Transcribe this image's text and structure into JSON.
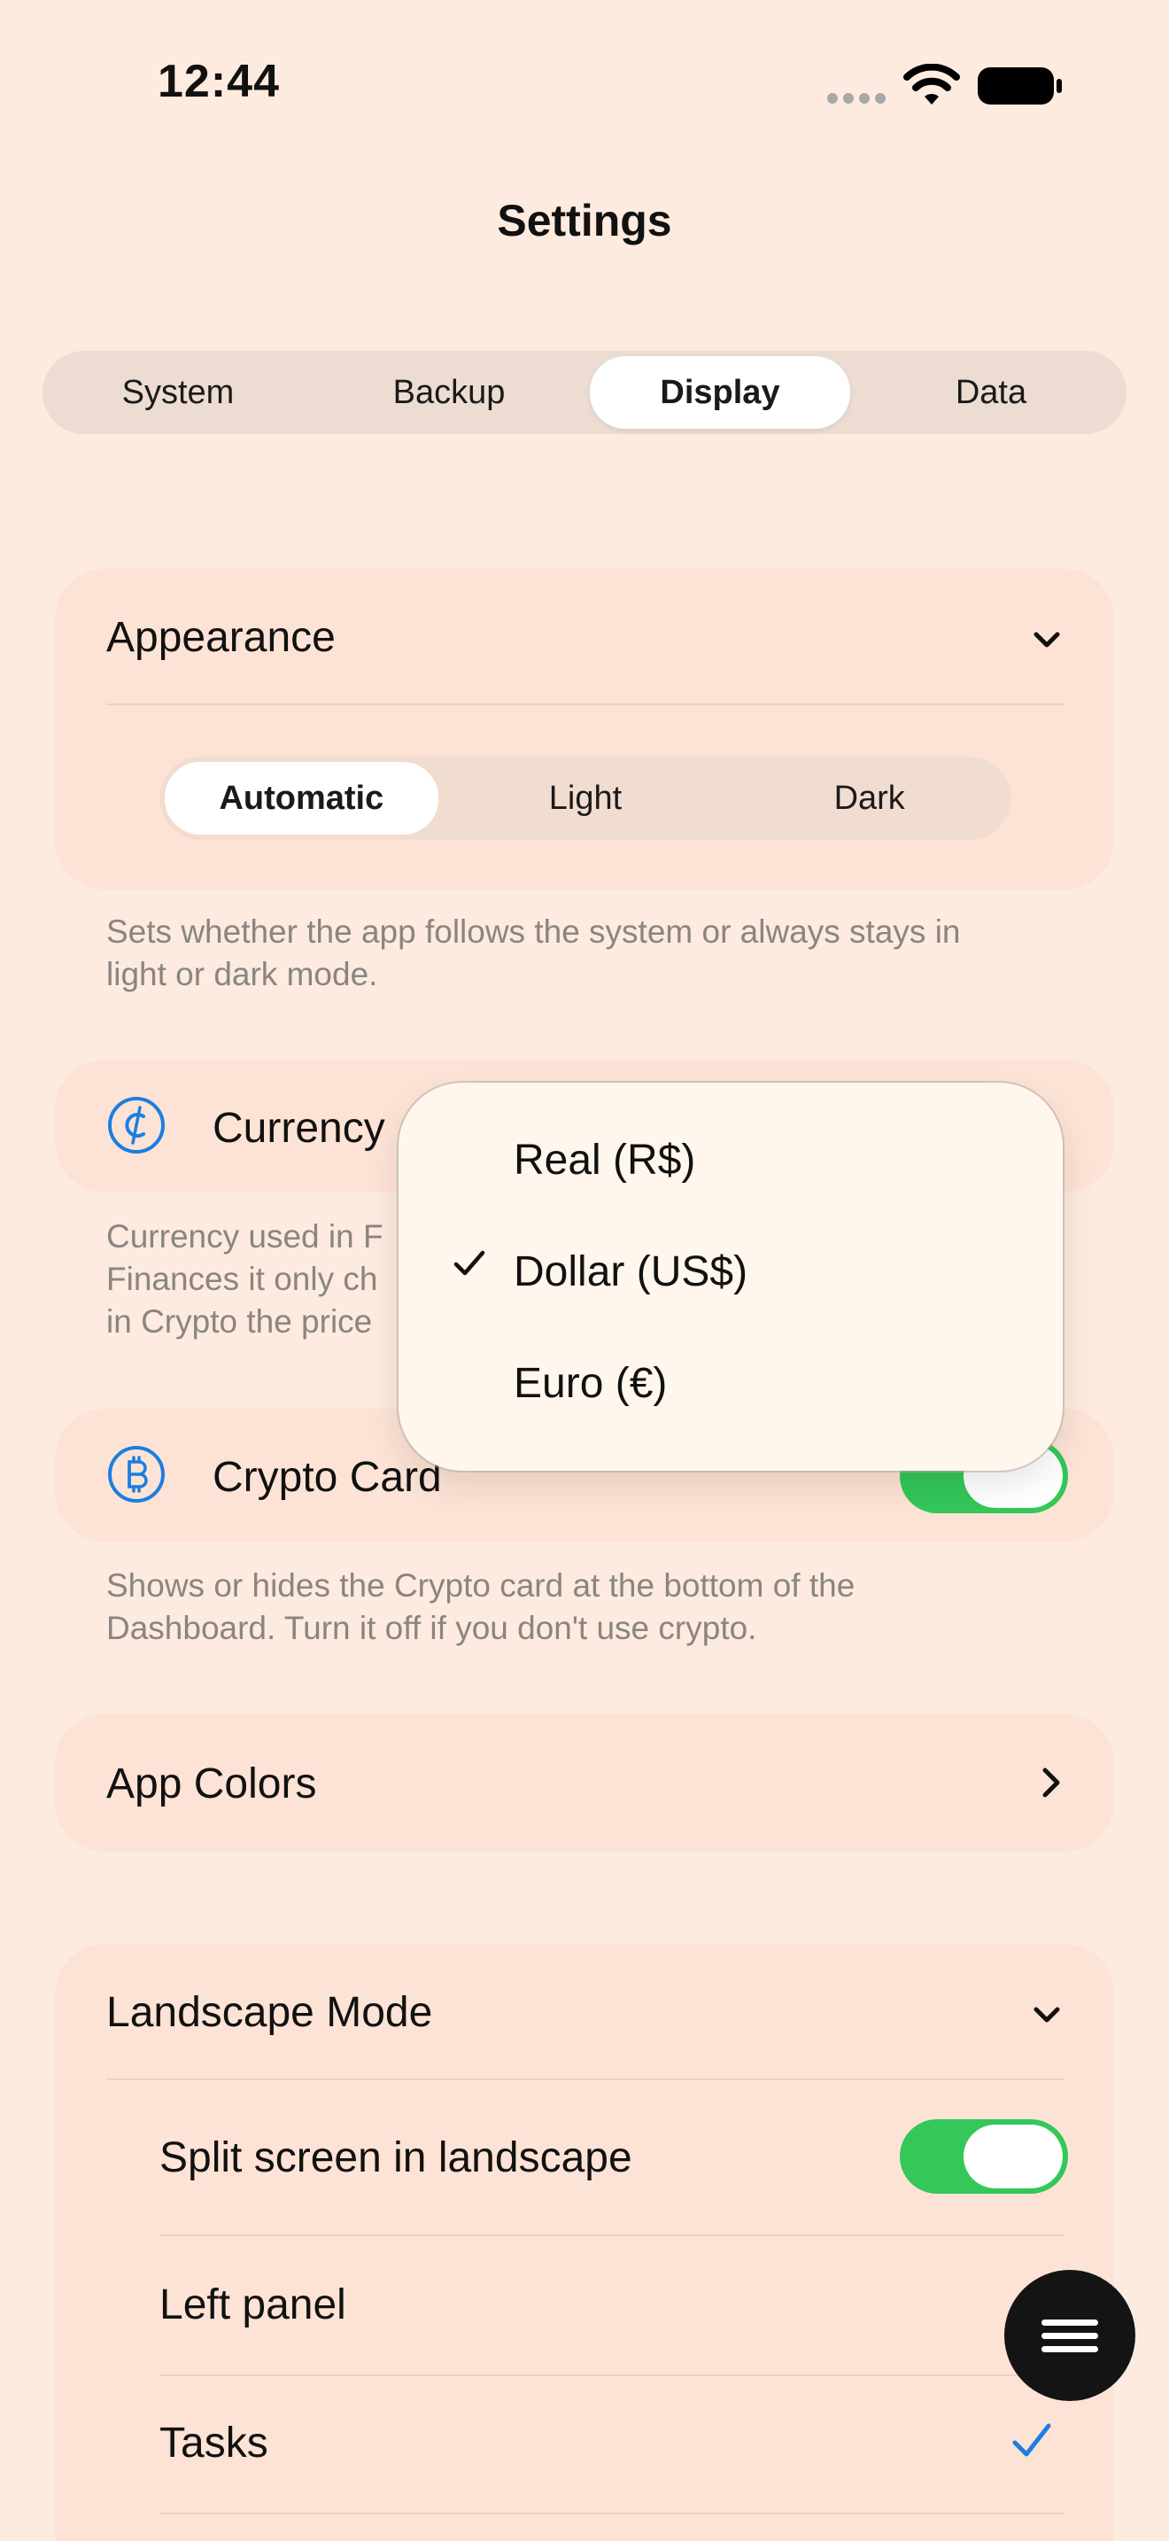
{
  "status_bar": {
    "time": "12:44"
  },
  "header": {
    "title": "Settings"
  },
  "tabs": [
    {
      "label": "System",
      "active": false
    },
    {
      "label": "Backup",
      "active": false
    },
    {
      "label": "Display",
      "active": true
    },
    {
      "label": "Data",
      "active": false
    }
  ],
  "appearance": {
    "title": "Appearance",
    "options": [
      {
        "label": "Automatic",
        "active": true
      },
      {
        "label": "Light",
        "active": false
      },
      {
        "label": "Dark",
        "active": false
      }
    ],
    "helper_line1": "Sets whether the app follows the system or always stays in",
    "helper_line2": "light or dark mode."
  },
  "currency": {
    "title": "Currency",
    "icon": "cent-icon",
    "helper_line1": "Currency used in F",
    "helper_line2": "Finances it only ch",
    "helper_line3": "in Crypto the price"
  },
  "currency_menu": {
    "items": [
      {
        "label": "Real (R$)",
        "selected": false
      },
      {
        "label": "Dollar (US$)",
        "selected": true
      },
      {
        "label": "Euro (€)",
        "selected": false
      }
    ]
  },
  "crypto_card": {
    "title": "Crypto Card",
    "icon": "bitcoin-icon",
    "enabled": true,
    "helper_line1": "Shows or hides the Crypto card at the bottom of the",
    "helper_line2": "Dashboard. Turn it off if you don't use crypto."
  },
  "app_colors": {
    "title": "App Colors"
  },
  "landscape": {
    "title": "Landscape Mode",
    "split_label": "Split screen in landscape",
    "split_enabled": true,
    "left_panel_label": "Left panel",
    "tasks_label": "Tasks"
  },
  "colors": {
    "accent_green": "#34c759",
    "accent_blue": "#1a7fe0",
    "background": "#fdebdf"
  }
}
